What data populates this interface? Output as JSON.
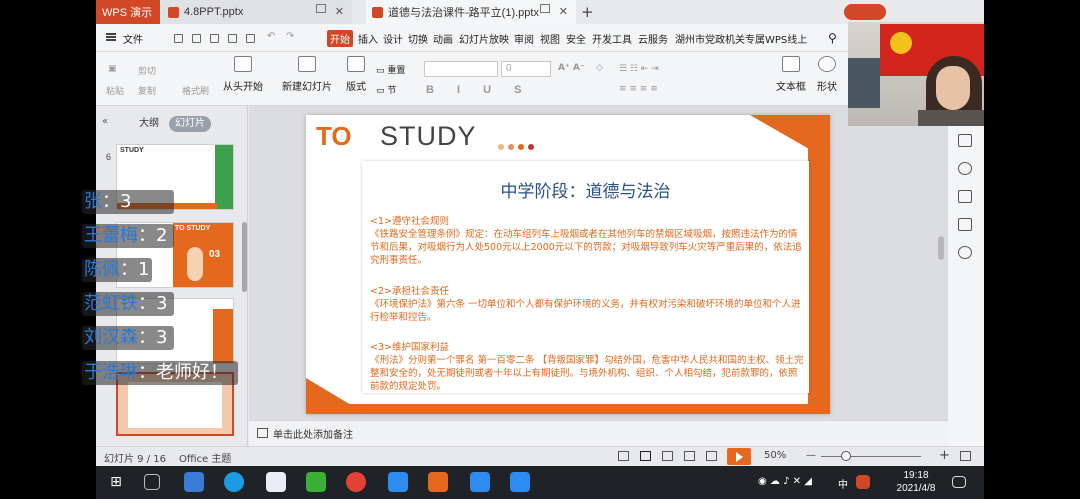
{
  "tabs": {
    "home": "WPS 演示",
    "tab1": "4.8PPT.pptx",
    "tab2": "道德与法治课件-路平立(1).pptx"
  },
  "menu": {
    "file": "文件",
    "items": [
      "开始",
      "插入",
      "设计",
      "切换",
      "动画",
      "幻灯片放映",
      "审阅",
      "视图",
      "安全",
      "开发工具",
      "云服务",
      "湖州市党政机关专属WPS线上"
    ]
  },
  "ribbon": {
    "paste": "粘贴",
    "cut": "剪切",
    "copy": "复制",
    "format_painter": "格式刷",
    "from_start": "从头开始",
    "new_slide": "新建幻灯片",
    "layout": "版式",
    "section": "节",
    "reset": "重置",
    "font_size": "0",
    "textbox": "文本框",
    "shape": "形状"
  },
  "left_panel": {
    "outline": "大纲",
    "slides": "幻灯片",
    "thumb_num": "6",
    "thumb_tag_a": "STUDY",
    "thumb_tag_b": "TO STUDY",
    "thumb_num_b": "03"
  },
  "chat": [
    {
      "name": "张",
      "sep": "：",
      "msg": "3"
    },
    {
      "name": "王蕾梅",
      "sep": "：",
      "msg": "2"
    },
    {
      "name": "陈佩",
      "sep": "：",
      "msg": "1"
    },
    {
      "name": "范虹铁",
      "sep": "：",
      "msg": "3"
    },
    {
      "name": "刘汉森",
      "sep": "：",
      "msg": "3"
    },
    {
      "name": "于浩琳",
      "sep": "：",
      "msg": "老师好！"
    }
  ],
  "slide": {
    "to": "TO",
    "study": "STUDY",
    "title": "中学阶段：道德与法治",
    "p1_head": "<1>遵守社会规则",
    "p1_body": "《铁路安全管理条例》规定：在动车组列车上吸烟或者在其他列车的禁烟区域吸烟，按照违法作为的情节和后果，对吸烟行为人处500元以上2000元以下的罚款；对吸烟导致列车火灾等严重后果的，依法追究刑事责任。",
    "p2_head": "<2>承担社会责任",
    "p2_body": "《环境保护法》第六条 一切单位和个人都有保护环境的义务，并有权对污染和破坏环境的单位和个人进行检举和控告。",
    "p3_head": "<3>维护国家利益",
    "p3_body": "《刑法》分则第一个罪名 第一百零二条 【背叛国家罪】勾结外国，危害中华人民共和国的主权、领土完整和安全的，处无期徒刑或者十年以上有期徒刑。与境外机构、组织、个人相勾结，犯前款罪的，依照前款的规定处罚。"
  },
  "notes": "单击此处添加备注",
  "status": {
    "slide_info": "幻灯片 9 / 16",
    "theme": "Office 主题",
    "zoom": "50%"
  },
  "taskbar": {
    "time": "19:18",
    "date": "2021/4/8",
    "ime": "中"
  },
  "colors": {
    "accent": "#e4681d",
    "title_blue": "#2a4f87",
    "chat_blue": "#2a78d6"
  }
}
